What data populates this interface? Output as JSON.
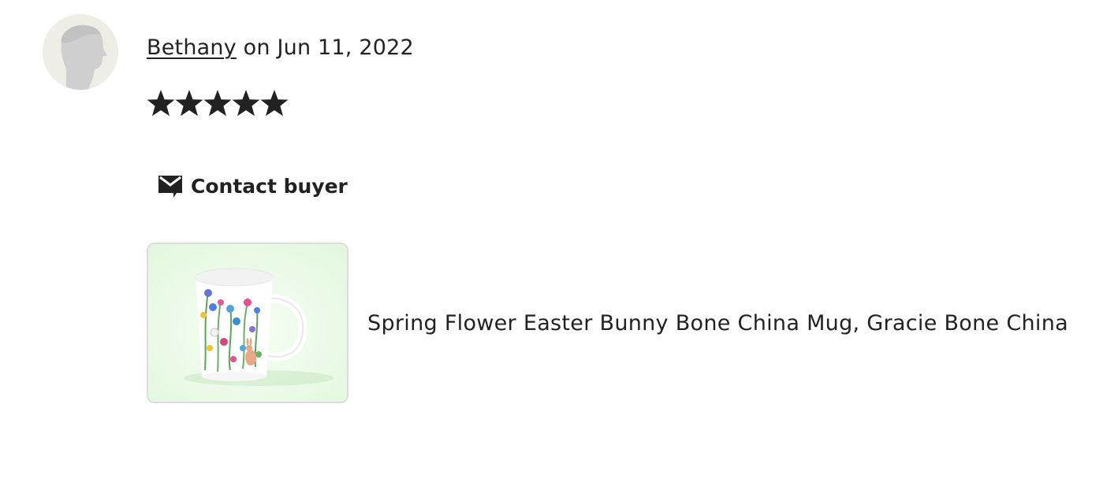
{
  "review": {
    "reviewer_name": "Bethany",
    "date_text": " on Jun 11, 2022",
    "rating": 5,
    "rating_max": 5,
    "avatar_icon": "default-profile-silhouette",
    "contact_button": {
      "label": "Contact buyer",
      "icon": "mail-icon"
    },
    "listing": {
      "title": "Spring Flower Easter Bunny Bone China Mug, Gracie Bone China",
      "image_description_icon": "floral-mug-thumbnail"
    }
  },
  "colors": {
    "text": "#222222",
    "avatar_bg": "#eeeee6",
    "avatar_figure": "#cfcfcf",
    "thumb_bg": "#eafbe8",
    "thumb_border": "#dcdcdc"
  }
}
